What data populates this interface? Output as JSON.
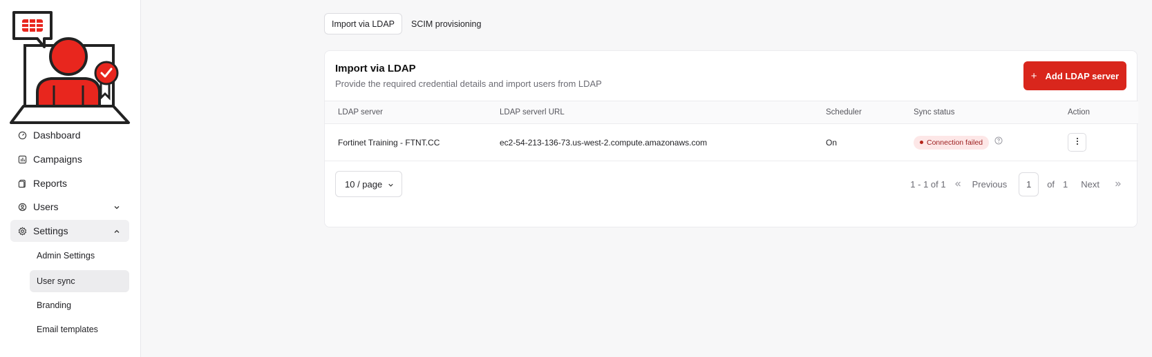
{
  "sidebar": {
    "nav": [
      {
        "label": "Dashboard",
        "icon": "gauge-icon"
      },
      {
        "label": "Campaigns",
        "icon": "chart-icon"
      },
      {
        "label": "Reports",
        "icon": "document-icon"
      },
      {
        "label": "Users",
        "icon": "user-circle-icon"
      },
      {
        "label": "Settings",
        "icon": "gear-icon"
      }
    ],
    "settings_sub": [
      {
        "label": "Admin Settings"
      },
      {
        "label": "User sync"
      },
      {
        "label": "Branding"
      },
      {
        "label": "Email templates"
      }
    ]
  },
  "tabs": [
    {
      "label": "Import via LDAP",
      "active": true
    },
    {
      "label": "SCIM provisioning",
      "active": false
    }
  ],
  "card": {
    "title": "Import via LDAP",
    "description": "Provide the required credential details and import users from LDAP",
    "add_button": "Add LDAP server"
  },
  "table": {
    "columns": [
      "LDAP server",
      "LDAP serverl URL",
      "Scheduler",
      "Sync status",
      "Action"
    ],
    "rows": [
      {
        "server": "Fortinet Training - FTNT.CC",
        "url": "ec2-54-213-136-73.us-west-2.compute.amazonaws.com",
        "scheduler": "On",
        "status": "Connection failed"
      }
    ]
  },
  "pagination": {
    "page_size": "10 / page",
    "range": "1 - 1 of 1",
    "previous": "Previous",
    "current_page": "1",
    "of": "of",
    "total_pages": "1",
    "next": "Next"
  },
  "colors": {
    "brand_red": "#d9261c",
    "status_failed_bg": "#fde7e7",
    "status_failed_text": "#9b1c1c"
  }
}
